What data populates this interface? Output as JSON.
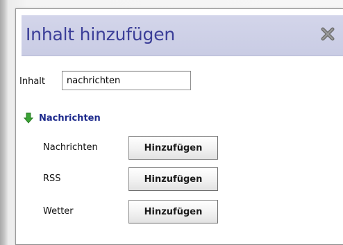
{
  "dialog": {
    "title": "Inhalt hinzufügen",
    "close_icon": "close-x-icon"
  },
  "search": {
    "label": "Inhalt",
    "value": "nachrichten"
  },
  "category": {
    "icon": "green-down-arrow-icon",
    "title": "Nachrichten"
  },
  "feeds": [
    {
      "name": "Nachrichten",
      "button_label": "Hinzufügen"
    },
    {
      "name": "RSS",
      "button_label": "Hinzufügen"
    },
    {
      "name": "Wetter",
      "button_label": "Hinzufügen"
    }
  ],
  "colors": {
    "titlebar_bg": "#cfd1e8",
    "title_text": "#3b3e98",
    "category_text": "#1d2a8c",
    "arrow_green": "#3aa335"
  }
}
